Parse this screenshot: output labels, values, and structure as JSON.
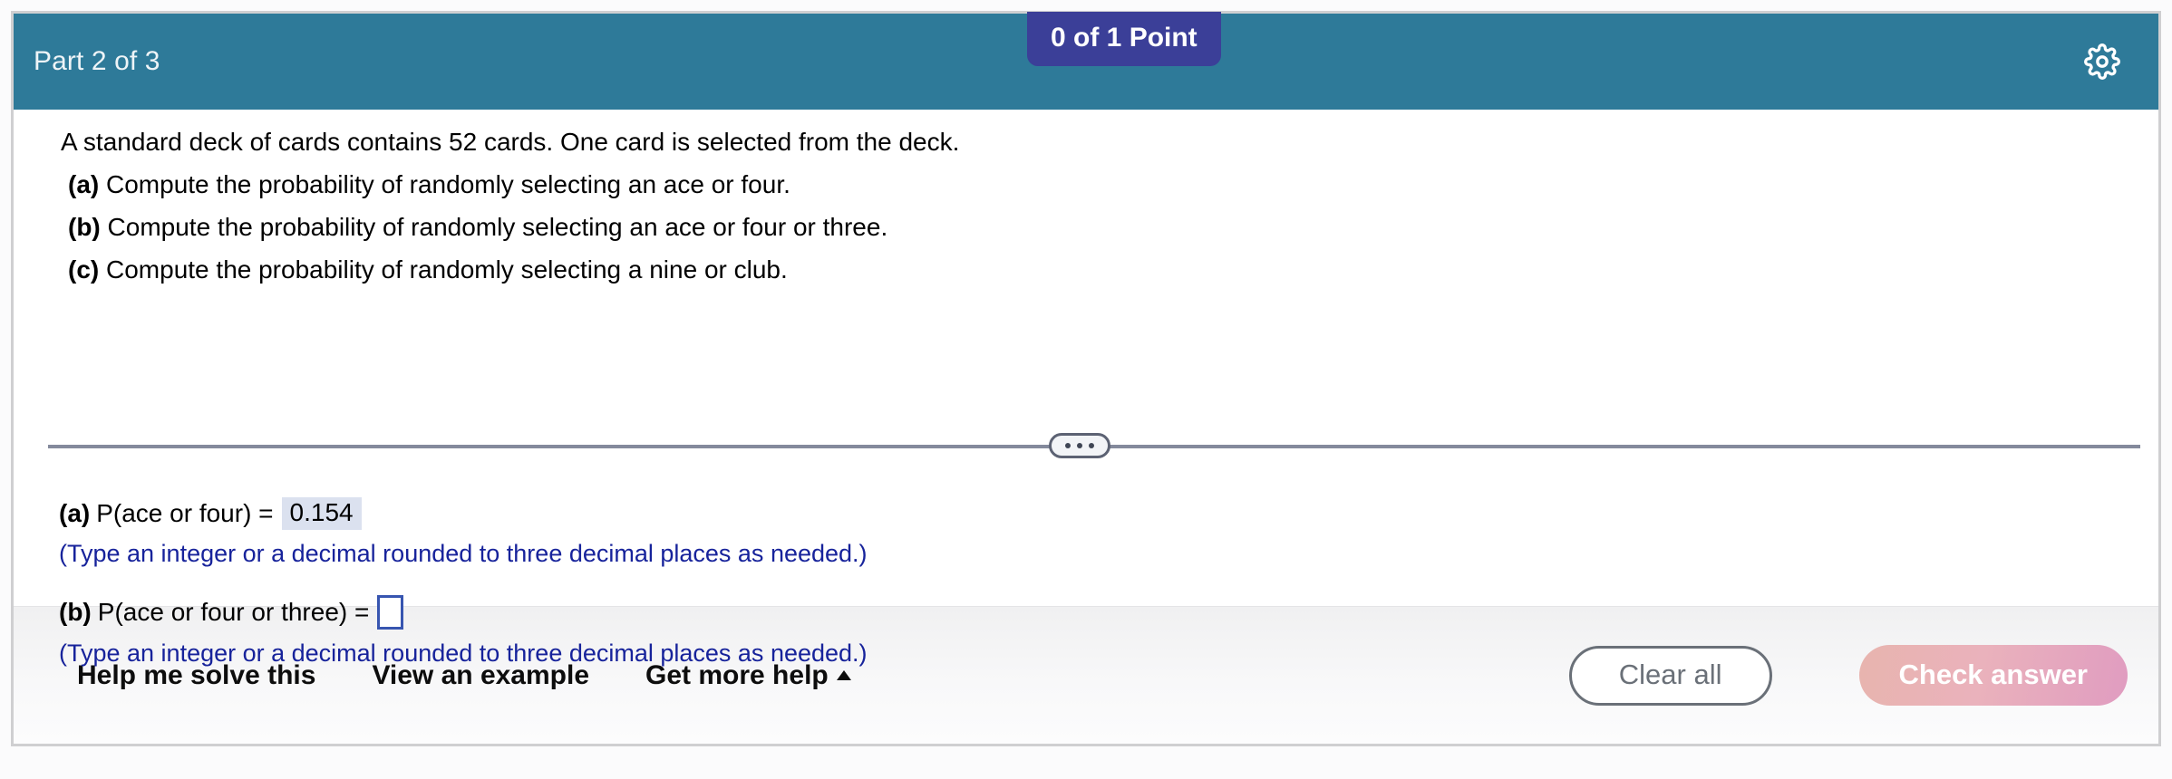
{
  "header": {
    "part_label": "Part 2 of 3",
    "points_badge": "0 of 1 Point",
    "settings_icon": "gear-icon",
    "bg_color": "#2e7a99",
    "badge_color": "#3b3f98"
  },
  "question": {
    "stem": "A standard deck of cards contains 52 cards. One card is selected from the deck.",
    "parts": [
      {
        "label": "(a)",
        "text": "Compute the probability of randomly selecting an ace or four."
      },
      {
        "label": "(b)",
        "text": "Compute the probability of randomly selecting an ace or four or three."
      },
      {
        "label": "(c)",
        "text": "Compute the probability of randomly selecting a nine or club."
      }
    ]
  },
  "divider": {
    "expander_icon": "ellipsis-icon",
    "line_color": "#848a9c"
  },
  "answers": [
    {
      "label": "(a)",
      "expression": "P(ace or four) =",
      "value": "0.154",
      "filled": true,
      "hint": "(Type an integer or a decimal rounded to three decimal places as needed.)"
    },
    {
      "label": "(b)",
      "expression": "P(ace or four or three) =",
      "value": "",
      "filled": false,
      "hint": "(Type an integer or a decimal rounded to three decimal places as needed.)"
    }
  ],
  "footer": {
    "help_me_solve_this": "Help me solve this",
    "view_an_example": "View an example",
    "get_more_help": "Get more help",
    "clear_all": "Clear all",
    "check_answer": "Check answer"
  },
  "colors": {
    "hint_text": "#17239b",
    "filled_answer_bg": "#dbe1ef",
    "input_border": "#3755b0",
    "check_button": "#eab2bc"
  }
}
